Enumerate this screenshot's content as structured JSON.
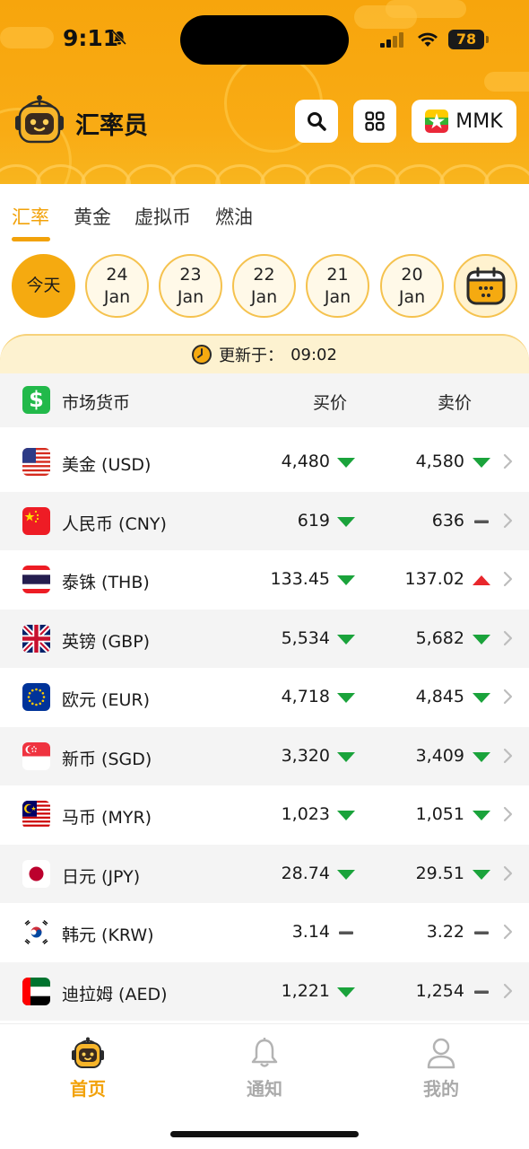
{
  "status_bar": {
    "time": "9:11",
    "battery": "78"
  },
  "header": {
    "title": "汇率员",
    "currency_label": "MMK"
  },
  "tabs": [
    {
      "label": "汇率"
    },
    {
      "label": "黄金"
    },
    {
      "label": "虚拟币"
    },
    {
      "label": "燃油"
    }
  ],
  "dates": [
    {
      "label": "今天"
    },
    {
      "day": "24",
      "month": "Jan"
    },
    {
      "day": "23",
      "month": "Jan"
    },
    {
      "day": "22",
      "month": "Jan"
    },
    {
      "day": "21",
      "month": "Jan"
    },
    {
      "day": "20",
      "month": "Jan"
    }
  ],
  "update": {
    "label": "更新于：",
    "time": "09:02"
  },
  "table": {
    "headers": {
      "currency": "市场货币",
      "buy": "买价",
      "sell": "卖价"
    },
    "rows": [
      {
        "name": "美金 (USD)",
        "buy": "4,480",
        "buy_trend": "down",
        "sell": "4,580",
        "sell_trend": "down"
      },
      {
        "name": "人民币 (CNY)",
        "buy": "619",
        "buy_trend": "down",
        "sell": "636",
        "sell_trend": "flat"
      },
      {
        "name": "泰铢 (THB)",
        "buy": "133.45",
        "buy_trend": "down",
        "sell": "137.02",
        "sell_trend": "up"
      },
      {
        "name": "英镑 (GBP)",
        "buy": "5,534",
        "buy_trend": "down",
        "sell": "5,682",
        "sell_trend": "down"
      },
      {
        "name": "欧元 (EUR)",
        "buy": "4,718",
        "buy_trend": "down",
        "sell": "4,845",
        "sell_trend": "down"
      },
      {
        "name": "新币 (SGD)",
        "buy": "3,320",
        "buy_trend": "down",
        "sell": "3,409",
        "sell_trend": "down"
      },
      {
        "name": "马币 (MYR)",
        "buy": "1,023",
        "buy_trend": "down",
        "sell": "1,051",
        "sell_trend": "down"
      },
      {
        "name": "日元 (JPY)",
        "buy": "28.74",
        "buy_trend": "down",
        "sell": "29.51",
        "sell_trend": "down"
      },
      {
        "name": "韩元 (KRW)",
        "buy": "3.14",
        "buy_trend": "flat",
        "sell": "3.22",
        "sell_trend": "flat"
      },
      {
        "name": "迪拉姆 (AED)",
        "buy": "1,221",
        "buy_trend": "down",
        "sell": "1,254",
        "sell_trend": "flat"
      }
    ]
  },
  "bottom_nav": [
    {
      "label": "首页"
    },
    {
      "label": "通知"
    },
    {
      "label": "我的"
    }
  ],
  "colors": {
    "accent": "#f2a20a",
    "down": "#1aa33b",
    "up": "#e8272c",
    "flat": "#555555"
  }
}
